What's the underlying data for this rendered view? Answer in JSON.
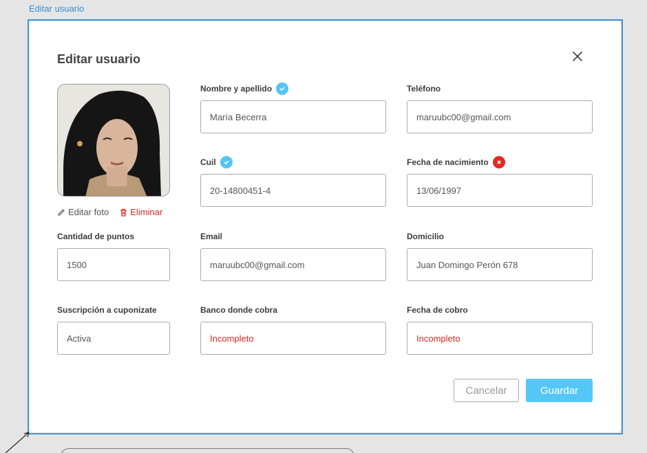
{
  "frame": {
    "label": "Editar usuario"
  },
  "modal": {
    "title": "Editar usuario",
    "photo_actions": {
      "edit": "Editar foto",
      "delete": "Eliminar"
    },
    "fields": {
      "nombre": {
        "label": "Nombre y apellido",
        "value": "María Becerra",
        "status": "verified"
      },
      "telefono": {
        "label": "Teléfono",
        "value": "maruubc00@gmail.com"
      },
      "cuil": {
        "label": "Cuil",
        "value": "20-14800451-4",
        "status": "verified"
      },
      "fecha_nacimiento": {
        "label": "Fecha de nacimiento",
        "value": "13/06/1997",
        "status": "error"
      },
      "puntos": {
        "label": "Cantidad de puntos",
        "value": "1500"
      },
      "email": {
        "label": "Email",
        "value": "maruubc00@gmail.com"
      },
      "domicilio": {
        "label": "Domicilio",
        "value": "Juan Domingo Perón 678"
      },
      "suscripcion": {
        "label": "Suscripción a cuponizate",
        "value": "Activa"
      },
      "banco": {
        "label": "Banco donde cobra",
        "value": "Incompleto"
      },
      "fecha_cobro": {
        "label": "Fecha de cobro",
        "value": "Incompleto"
      }
    },
    "buttons": {
      "cancel": "Cancelar",
      "save": "Guardar"
    }
  },
  "colors": {
    "accent": "#55c7f7",
    "selection": "#3b95df",
    "error": "#d42a20",
    "verified": "#55c4f3"
  }
}
